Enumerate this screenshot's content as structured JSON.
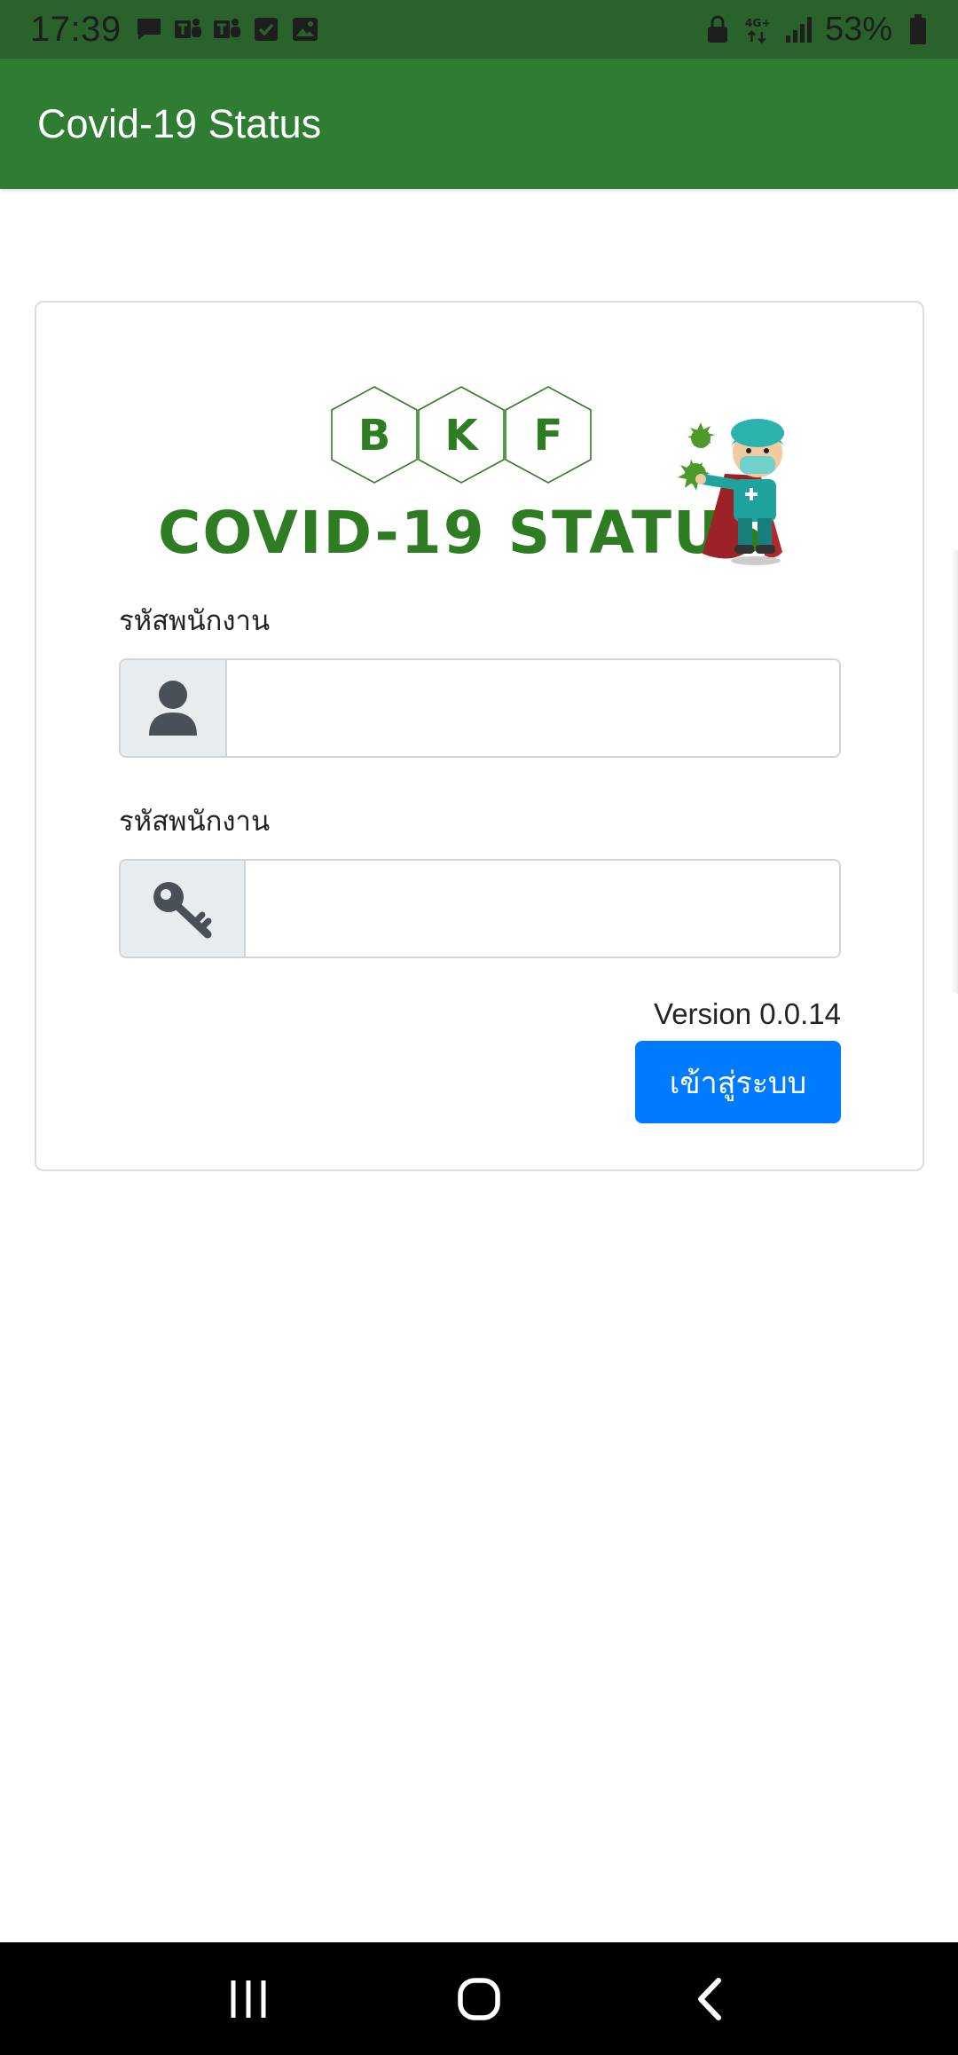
{
  "status_bar": {
    "time": "17:39",
    "battery": "53%",
    "network": "4G+",
    "left_icons": [
      "message-icon",
      "teams-icon",
      "teams-icon",
      "checkbox-icon",
      "image-icon"
    ],
    "right_icons": [
      "lock-icon",
      "network-icon",
      "signal-icon",
      "battery-icon"
    ]
  },
  "app_bar": {
    "title": "Covid-19 Status",
    "color": "#2e7d32"
  },
  "logo": {
    "letters": [
      "B",
      "K",
      "F"
    ],
    "text": "COVID-19 STATUS",
    "color": "#2e7d22"
  },
  "form": {
    "employee_code_label": "รหัสพนักงาน",
    "password_label": "รหัสพนักงาน",
    "employee_code_value": "",
    "password_value": "",
    "user_icon": "user-icon",
    "key_icon": "key-icon"
  },
  "version": "Version 0.0.14",
  "login_button": {
    "label": "เข้าสู่ระบบ",
    "color": "#007bff"
  },
  "nav_bar": {
    "buttons": [
      "recent-apps-icon",
      "home-icon",
      "back-icon"
    ]
  }
}
